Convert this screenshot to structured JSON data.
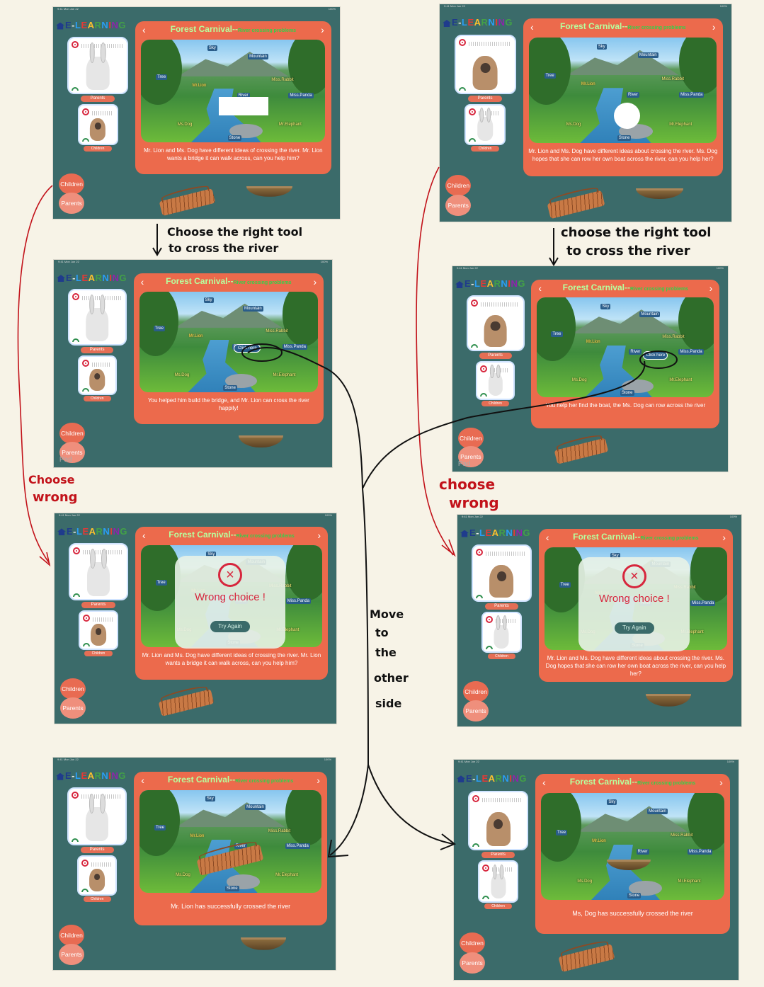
{
  "app": {
    "logo": "E-LEARNING",
    "status_time": "9:41  Mon Jun 22",
    "status_right": "100%",
    "panel_title": "Forest Carnival--",
    "panel_subtitle": "River crossing problems",
    "role_children": "Children",
    "role_parents": "Parents",
    "pill_parents": "Parents",
    "pill_children": "Children",
    "click_here": "Click here",
    "wrong_choice": "Wrong choice !",
    "try_again": "Try Again",
    "pad_label": "Pad"
  },
  "scene_labels": {
    "sky": "Sky",
    "mountain": "Mountain",
    "tree": "Tree",
    "river": "River",
    "stone": "Stone",
    "mr_lion": "Mr.Lion",
    "miss_rabbit": "Miss.Rabbit",
    "miss_panda": "Miss.Panda",
    "ms_dog": "Ms.Dog",
    "mr_elephant": "Mr.Elephant"
  },
  "texts": {
    "lion_prompt": "Mr. Lion and Ms. Dog have different ideas of crossing the river. Mr. Lion wants a bridge it can walk across, can you help him?",
    "dog_prompt": "Mr. Lion and Ms. Dog have different ideas about crossing the river. Ms. Dog hopes that she can row her own boat across the river, can you help her?",
    "lion_helped": "You helped him build the bridge, and Mr. Lion can cross the river happily!",
    "dog_helped": "You help her find the boat, the Ms. Dog can row across the river",
    "lion_success": "Mr. Lion has successfully crossed the river",
    "dog_success": "Ms, Dog has successfully crossed the river"
  },
  "annotations": {
    "choose_tool_left_1": "Choose the right tool",
    "choose_tool_left_2": "to cross the river",
    "choose_tool_right_1": "choose the right tool",
    "choose_tool_right_2": "to cross the river",
    "wrong_left_1": "Choose",
    "wrong_left_2": "wrong",
    "wrong_right_1": "choose",
    "wrong_right_2": "wrong",
    "move_1": "Move",
    "move_2": "to",
    "move_3": "the",
    "move_4": "other",
    "move_5": "side"
  },
  "colors": {
    "background": "#f7f3e7",
    "screen": "#3b6b6a",
    "panel": "#ec6a4c",
    "arrow_black": "#111111",
    "arrow_red": "#c2121a",
    "error": "#d7263d"
  }
}
